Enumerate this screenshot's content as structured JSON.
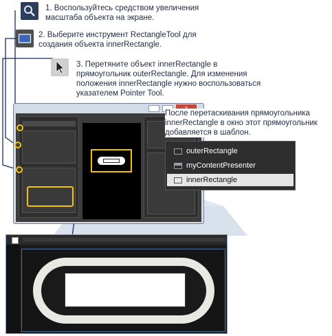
{
  "steps": [
    {
      "number": "1.",
      "text": "Воспользуйтесь средством увеличения масштаба объекта на экране.",
      "icon": "zoom-icon"
    },
    {
      "number": "2.",
      "text": "Выберите инструмент RectangleTool для создания объекта innerRectangle.",
      "icon": "rectangle-tool-icon"
    },
    {
      "number": "3.",
      "text": "Перетяните объект innerRectangle в прямоугольник outerRectangle. Для изменения положения innerRectangle нужно воспользоваться указателем Pointer Tool.",
      "icon": "pointer-tool-icon"
    }
  ],
  "callout": {
    "text": "После перетаскивания прямоугольника innerRectangle в окно этот прямоугольник добавляется в шаблон."
  },
  "window": {
    "close_glyph": "x"
  },
  "objects_panel": {
    "items": [
      {
        "label": "outerRectangle",
        "icon": "rectangle-icon",
        "selected": false
      },
      {
        "label": "myContentPresenter",
        "icon": "content-presenter-icon",
        "selected": false
      },
      {
        "label": "innerRectangle",
        "icon": "rectangle-icon",
        "selected": true
      }
    ]
  },
  "colors": {
    "accent_yellow": "#f5c400",
    "lead_navy": "#1b2a5e",
    "panel_dark": "#2b2b2b",
    "selection": "#e6e6e6",
    "zoom_blue": "#4d6f9c"
  }
}
